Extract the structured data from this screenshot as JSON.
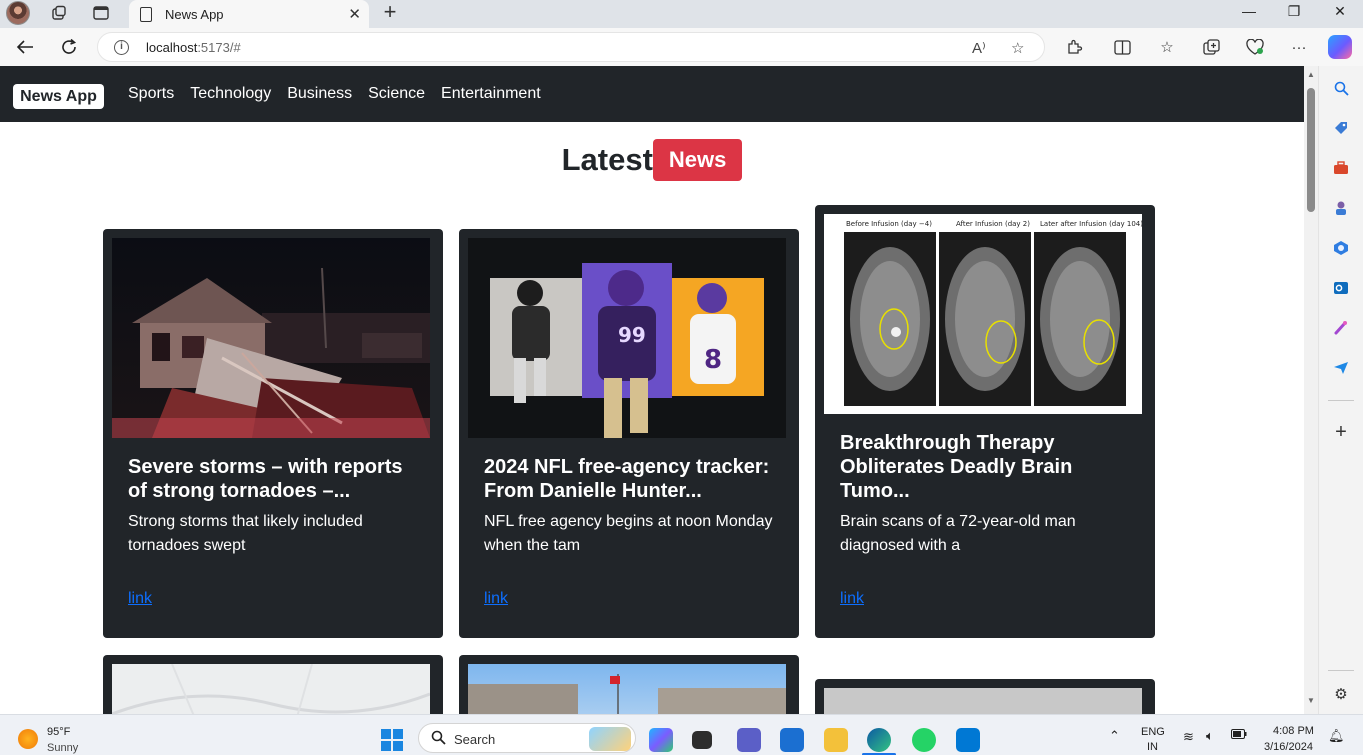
{
  "browser": {
    "tab_title": "News App",
    "url_host": "localhost",
    "url_rest": ":5173/#"
  },
  "page": {
    "brand": "News App",
    "nav": [
      "Sports",
      "Technology",
      "Business",
      "Science",
      "Entertainment"
    ],
    "heading": "Latest",
    "heading_badge": "News",
    "cards": [
      {
        "title": "Severe storms – with reports of strong tornadoes –...",
        "description": "Strong storms that likely included tornadoes swept",
        "link": "link",
        "image": "storm-damaged-house"
      },
      {
        "title": "2024 NFL free-agency tracker: From Danielle Hunter...",
        "description": "NFL free agency begins at noon Monday when the tam",
        "link": "link",
        "image": "nfl-players"
      },
      {
        "title": "Breakthrough Therapy Obliterates Deadly Brain Tumo...",
        "description": "Brain scans of a 72-year-old man diagnosed with a",
        "link": "link",
        "image": "brain-mri-scans",
        "image_caption": [
          "Before Infusion (day −4)",
          "After Infusion (day 2)",
          "Later after Infusion (day 104)"
        ]
      }
    ]
  },
  "taskbar": {
    "weather_temp": "95°F",
    "weather_desc": "Sunny",
    "search_placeholder": "Search",
    "lang_1": "ENG",
    "lang_2": "IN",
    "time": "4:08 PM",
    "date": "3/16/2024"
  }
}
